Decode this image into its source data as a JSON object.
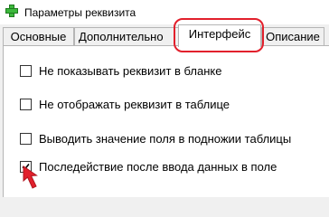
{
  "window": {
    "title": "Параметры реквизита"
  },
  "tabs": [
    {
      "label": "Основные",
      "active": false
    },
    {
      "label": "Дополнительно",
      "active": false
    },
    {
      "label": "Интерфейс",
      "active": true
    },
    {
      "label": "Описание",
      "active": false
    }
  ],
  "options": [
    {
      "label": "Не показывать реквизит в бланке",
      "checked": false
    },
    {
      "label": "Не отображать реквизит в таблице",
      "checked": false
    },
    {
      "label": "Выводить значение поля в подножии таблицы",
      "checked": false
    },
    {
      "label": "Последействие после ввода данных в поле",
      "checked": true
    }
  ],
  "annotations": {
    "highlight_color": "#e2202c",
    "arrow_color": "#e2202c",
    "icon": "green-plus-icon"
  }
}
